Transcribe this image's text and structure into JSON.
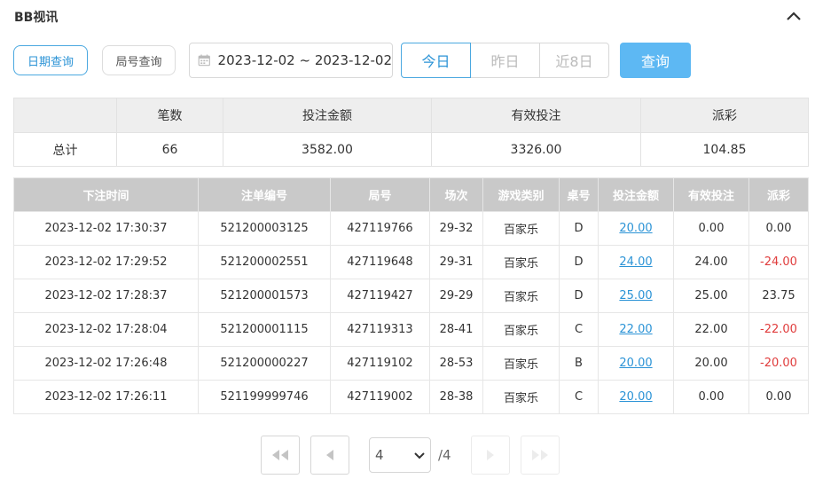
{
  "header": {
    "title": "BB视讯"
  },
  "toolbar": {
    "date_query_label": "日期查询",
    "round_query_label": "局号查询",
    "date_range": "2023-12-02 ~ 2023-12-02",
    "quick": [
      "今日",
      "昨日",
      "近8日"
    ],
    "search_label": "查询"
  },
  "summary": {
    "headers": [
      "",
      "笔数",
      "投注金额",
      "有效投注",
      "派彩"
    ],
    "row": [
      "总计",
      "66",
      "3582.00",
      "3326.00",
      "104.85"
    ]
  },
  "records": {
    "headers": [
      "下注时间",
      "注单编号",
      "局号",
      "场次",
      "游戏类别",
      "桌号",
      "投注金额",
      "有效投注",
      "派彩"
    ],
    "rows": [
      [
        "2023-12-02 17:30:37",
        "521200003125",
        "427119766",
        "29-32",
        "百家乐",
        "D",
        "20.00",
        "0.00",
        "0.00"
      ],
      [
        "2023-12-02 17:29:52",
        "521200002551",
        "427119648",
        "29-31",
        "百家乐",
        "D",
        "24.00",
        "24.00",
        "-24.00"
      ],
      [
        "2023-12-02 17:28:37",
        "521200001573",
        "427119427",
        "29-29",
        "百家乐",
        "D",
        "25.00",
        "25.00",
        "23.75"
      ],
      [
        "2023-12-02 17:28:04",
        "521200001115",
        "427119313",
        "28-41",
        "百家乐",
        "C",
        "22.00",
        "22.00",
        "-22.00"
      ],
      [
        "2023-12-02 17:26:48",
        "521200000227",
        "427119102",
        "28-53",
        "百家乐",
        "B",
        "20.00",
        "20.00",
        "-20.00"
      ],
      [
        "2023-12-02 17:26:11",
        "521199999746",
        "427119002",
        "28-38",
        "百家乐",
        "C",
        "20.00",
        "0.00",
        "0.00"
      ]
    ]
  },
  "pager": {
    "current": "4",
    "total": "/4"
  },
  "colors": {
    "accent": "#2b93d6",
    "search_button": "#5db8f3",
    "negative": "#e03c3c",
    "table_header": "#c9c9c9"
  }
}
